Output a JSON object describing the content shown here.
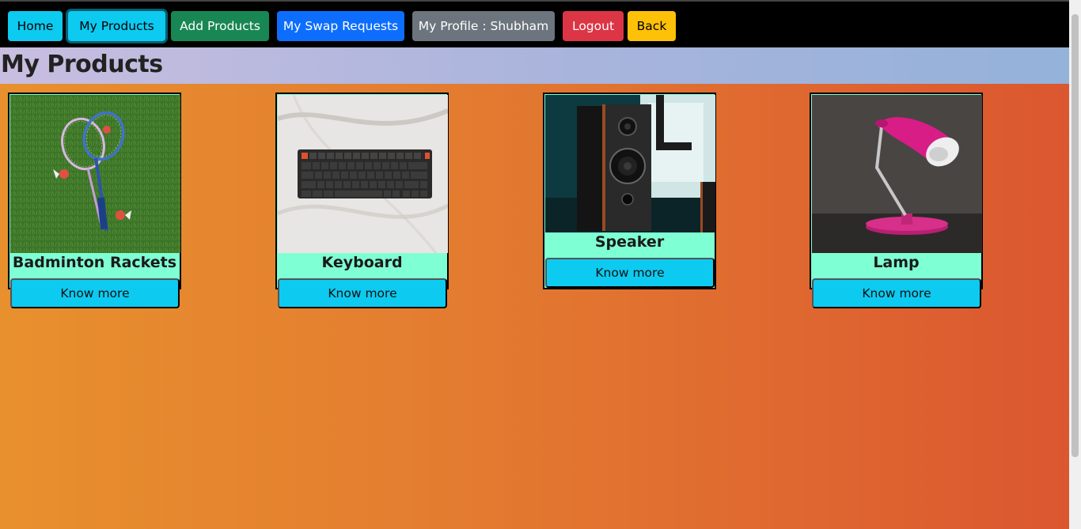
{
  "nav": {
    "home": "Home",
    "my_products": "My Products",
    "add_products": "Add Products",
    "swap_requests": "My Swap Requests",
    "profile": "My Profile : Shubham",
    "logout": "Logout",
    "back": "Back"
  },
  "page": {
    "title": "My Products"
  },
  "products": [
    {
      "name": "Badminton Rackets",
      "button": "Know more",
      "image": "badminton-rackets-photo"
    },
    {
      "name": "Keyboard",
      "button": "Know more",
      "image": "keyboard-photo"
    },
    {
      "name": "Speaker",
      "button": "Know more",
      "image": "speaker-photo"
    },
    {
      "name": "Lamp",
      "button": "Know more",
      "image": "lamp-photo"
    }
  ],
  "colors": {
    "info": "#0dcaf0",
    "success": "#198754",
    "primary": "#0d6efd",
    "secondary": "#6c757d",
    "danger": "#dc3545",
    "warning": "#ffc107",
    "card_label_bg": "#7fffd4"
  }
}
